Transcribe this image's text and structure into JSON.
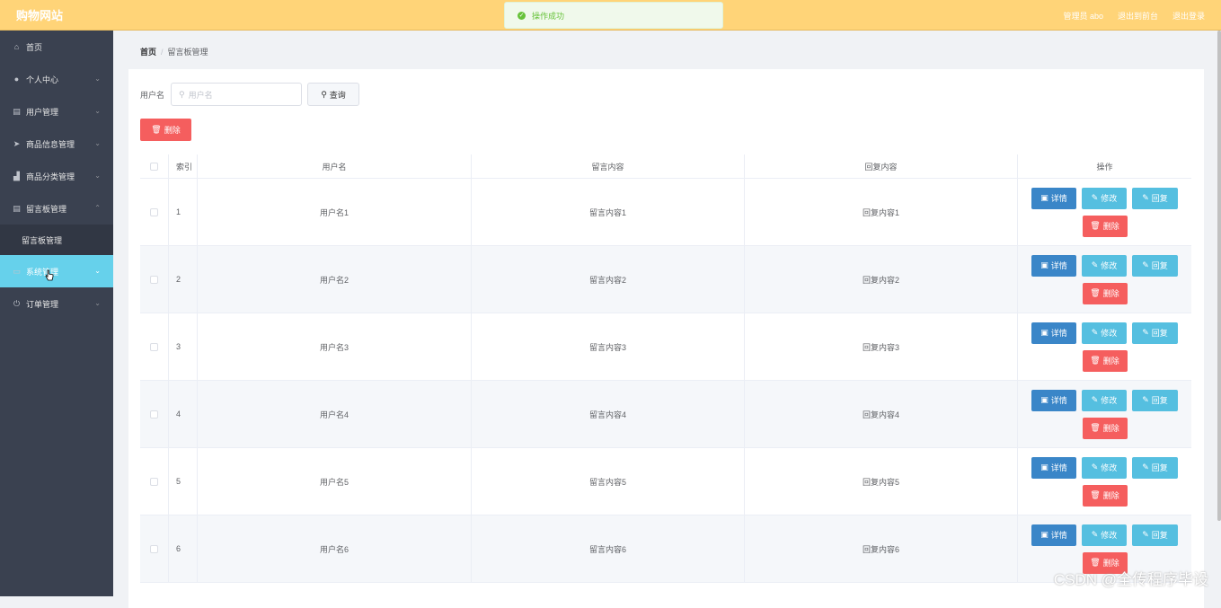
{
  "app": {
    "brand": "购物网站"
  },
  "toast": {
    "text": "操作成功"
  },
  "top_links": {
    "user": "管理员 abo",
    "front": "退出到前台",
    "logout": "退出登录"
  },
  "sidebar": {
    "items": [
      {
        "label": "首页",
        "icon": "home-icon"
      },
      {
        "label": "个人中心",
        "icon": "user-icon"
      },
      {
        "label": "用户管理",
        "icon": "clipboard-icon"
      },
      {
        "label": "商品信息管理",
        "icon": "send-icon"
      },
      {
        "label": "商品分类管理",
        "icon": "chart-icon"
      },
      {
        "label": "留言板管理",
        "icon": "clipboard-icon"
      },
      {
        "label": "留言板管理"
      },
      {
        "label": "系统管理",
        "icon": "chat-icon"
      },
      {
        "label": "订单管理",
        "icon": "power-icon"
      }
    ]
  },
  "breadcrumb": {
    "home": "首页",
    "current": "留言板管理"
  },
  "search": {
    "label": "用户名",
    "placeholder": "用户名",
    "button": "查询"
  },
  "toolbar": {
    "delete": "删除"
  },
  "table": {
    "headers": {
      "index": "索引",
      "user": "用户名",
      "message": "留言内容",
      "reply": "回复内容",
      "actions": "操作"
    },
    "rows": [
      {
        "index": "1",
        "user": "用户名1",
        "message": "留言内容1",
        "reply": "回复内容1"
      },
      {
        "index": "2",
        "user": "用户名2",
        "message": "留言内容2",
        "reply": "回复内容2"
      },
      {
        "index": "3",
        "user": "用户名3",
        "message": "留言内容3",
        "reply": "回复内容3"
      },
      {
        "index": "4",
        "user": "用户名4",
        "message": "留言内容4",
        "reply": "回复内容4"
      },
      {
        "index": "5",
        "user": "用户名5",
        "message": "留言内容5",
        "reply": "回复内容5"
      },
      {
        "index": "6",
        "user": "用户名6",
        "message": "留言内容6",
        "reply": "回复内容6"
      }
    ],
    "actions": {
      "detail": "详情",
      "edit": "修改",
      "reply": "回复",
      "delete": "删除"
    }
  },
  "watermark": "CSDN @全传程序毕设"
}
